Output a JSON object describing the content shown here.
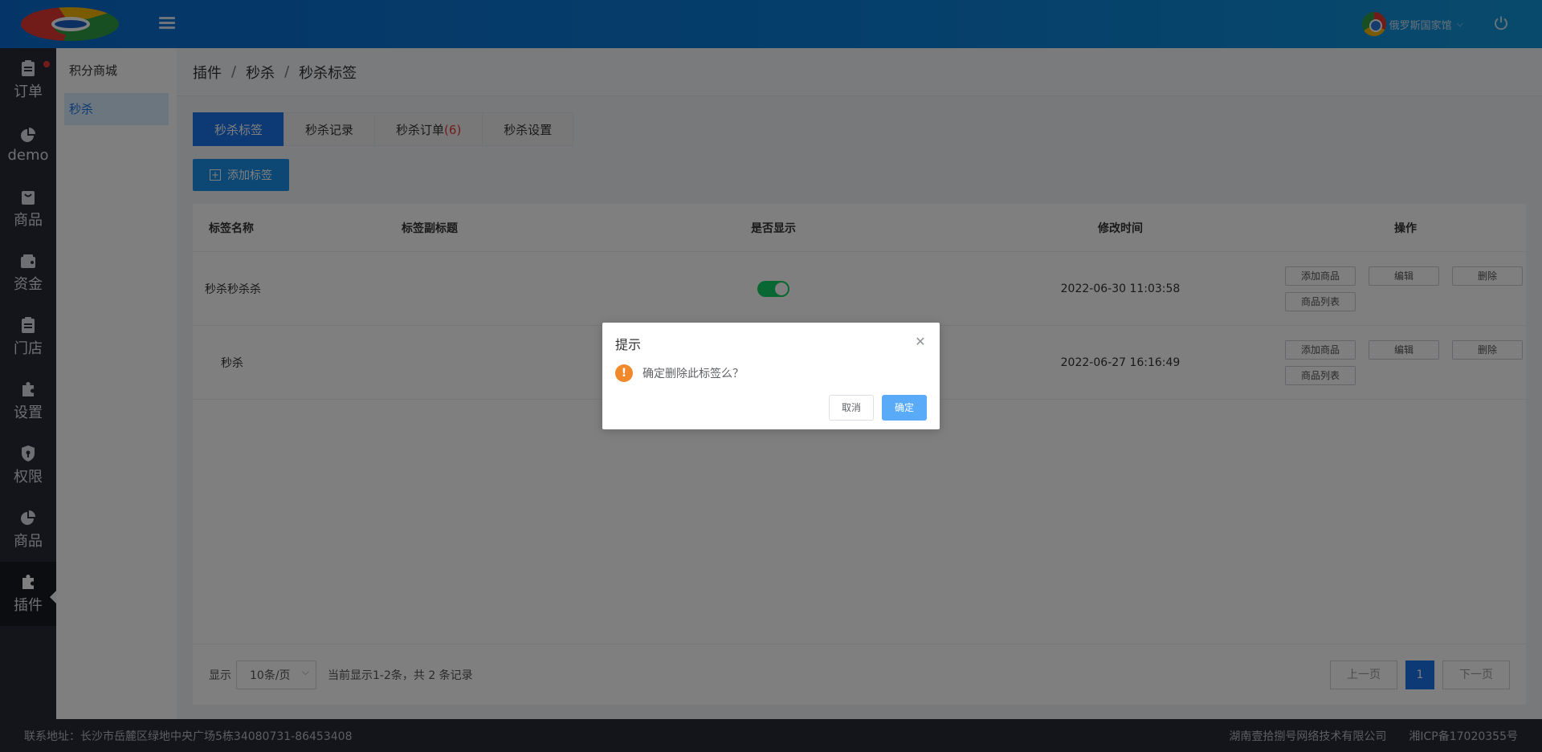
{
  "header": {
    "user_name": "俄罗斯国家馆",
    "logo_icon": "logo-icon",
    "menu_icon": "hamburger-icon",
    "power_icon": "power-icon"
  },
  "sidebar": {
    "items": [
      {
        "label": "订单",
        "icon": "clipboard-icon",
        "badge": true
      },
      {
        "label": "demo",
        "icon": "pie-chart-icon"
      },
      {
        "label": "商品",
        "icon": "bag-icon"
      },
      {
        "label": "资金",
        "icon": "wallet-icon"
      },
      {
        "label": "门店",
        "icon": "clipboard-icon"
      },
      {
        "label": "设置",
        "icon": "puzzle-icon"
      },
      {
        "label": "权限",
        "icon": "shield-icon"
      },
      {
        "label": "商品",
        "icon": "pie-chart-icon"
      },
      {
        "label": "插件",
        "icon": "puzzle-icon",
        "active": true
      }
    ]
  },
  "subsidebar": {
    "items": [
      {
        "label": "积分商城"
      },
      {
        "label": "秒杀",
        "active": true
      }
    ]
  },
  "breadcrumb": {
    "items": [
      "插件",
      "秒杀",
      "秒杀标签"
    ],
    "separator": "/"
  },
  "tabs": [
    {
      "label": "秒杀标签",
      "active": true
    },
    {
      "label": "秒杀记录"
    },
    {
      "label": "秒杀订单",
      "count": "(6)"
    },
    {
      "label": "秒杀设置"
    }
  ],
  "toolbar": {
    "add_label": "添加标签"
  },
  "table": {
    "columns": [
      "标签名称",
      "标签副标题",
      "是否显示",
      "修改时间",
      "操作"
    ],
    "rows": [
      {
        "name": "秒杀秒杀杀",
        "subtitle": "",
        "visible": true,
        "modified": "2022-06-30 11:03:58"
      },
      {
        "name": "秒杀",
        "subtitle": "",
        "visible": true,
        "modified": "2022-06-27 16:16:49"
      }
    ],
    "ops": [
      "添加商品",
      "编辑",
      "删除",
      "商品列表"
    ]
  },
  "pager": {
    "show_label": "显示",
    "page_size": "10条/页",
    "summary": "当前显示1-2条，共 2 条记录",
    "prev": "上一页",
    "current": "1",
    "next": "下一页"
  },
  "footer": {
    "address": "联系地址：长沙市岳麓区绿地中央广场5栋34080731-86453408",
    "company": "湖南壹拾捌号网络技术有限公司",
    "icp": "湘ICP备17020355号"
  },
  "dialog": {
    "title": "提示",
    "message": "确定删除此标签么？",
    "cancel": "取消",
    "ok": "确定"
  },
  "colors": {
    "primary": "#1a73e8",
    "header_start": "#0a6bd1",
    "header_end": "#1195d9",
    "sidebar_bg": "#262a35",
    "switch_on": "#13ce66",
    "warning": "#f0892b"
  }
}
